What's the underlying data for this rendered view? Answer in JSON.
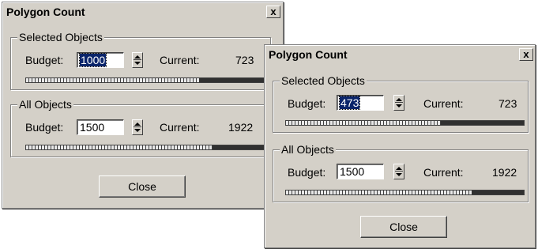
{
  "dialogs": [
    {
      "title": "Polygon Count",
      "close_glyph": "x",
      "selected_group": {
        "legend": "Selected Objects",
        "budget_label": "Budget:",
        "budget_value": "1000",
        "current_label": "Current:",
        "current_value": "723",
        "progress": 0.723
      },
      "all_group": {
        "legend": "All Objects",
        "budget_label": "Budget:",
        "budget_value": "1500",
        "current_label": "Current:",
        "current_value": "1922",
        "progress": 0.78
      },
      "close_button": "Close"
    },
    {
      "title": "Polygon Count",
      "close_glyph": "x",
      "selected_group": {
        "legend": "Selected Objects",
        "budget_label": "Budget:",
        "budget_value": "473",
        "current_label": "Current:",
        "current_value": "723",
        "progress": 0.65
      },
      "all_group": {
        "legend": "All Objects",
        "budget_label": "Budget:",
        "budget_value": "1500",
        "current_label": "Current:",
        "current_value": "1922",
        "progress": 0.78
      },
      "close_button": "Close"
    }
  ]
}
